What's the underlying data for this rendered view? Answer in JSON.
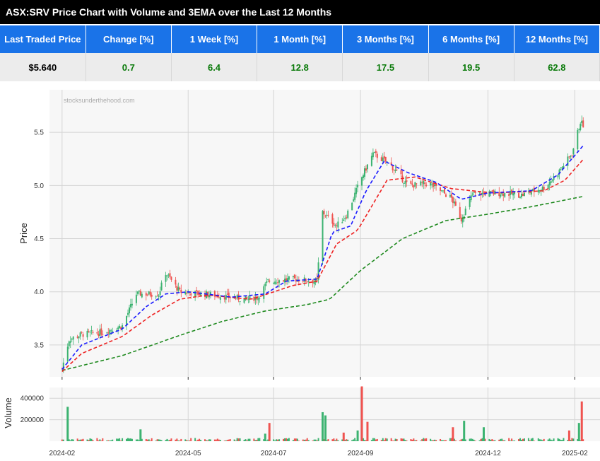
{
  "title": "ASX:SRV Price Chart with Volume and 3EMA over the Last 12 Months",
  "stats": {
    "headers": [
      "Last Traded Price",
      "Change [%]",
      "1 Week [%]",
      "1 Month [%]",
      "3 Months [%]",
      "6 Months [%]",
      "12 Months [%]"
    ],
    "values": [
      "$5.640",
      "0.7",
      "6.4",
      "12.8",
      "17.5",
      "19.5",
      "62.8"
    ]
  },
  "colors": {
    "header_bg": "#1a73e8",
    "positive": "#0a7a0a",
    "up_candle": "#3cb371",
    "down_candle": "#ef5350",
    "ema_fast": "#1a1aff",
    "ema_mid": "#ee2222",
    "ema_slow": "#1f8a1f"
  },
  "chart_data": {
    "type": "candlestick_with_volume",
    "watermark": "stocksunderthehood.com",
    "price_panel": {
      "ylabel": "Price",
      "ylim": [
        3.2,
        5.9
      ],
      "yticks": [
        3.5,
        4.0,
        4.5,
        5.0,
        5.5
      ],
      "ytick_labels": [
        "3.5",
        "4.0",
        "4.5",
        "5.0",
        "5.5"
      ]
    },
    "volume_panel": {
      "ylabel": "Volume",
      "ylim": [
        0,
        500000
      ],
      "yticks": [
        200000,
        400000
      ],
      "ytick_labels": [
        "200000",
        "400000"
      ]
    },
    "x_tick_labels": [
      {
        "date": "2024-02-01",
        "label": "2024-02"
      },
      {
        "date": "2024-05-01",
        "label": "2024-05"
      },
      {
        "date": "2024-07-01",
        "label": "2024-07"
      },
      {
        "date": "2024-09-01",
        "label": "2024-09"
      },
      {
        "date": "2024-12-01",
        "label": "2024-12"
      },
      {
        "date": "2025-02-01",
        "label": "2025-02"
      }
    ],
    "xlim": [
      "2024-01-23",
      "2025-02-19"
    ],
    "price_anchors": [
      [
        "2024-02-01",
        3.28
      ],
      [
        "2024-02-06",
        3.55
      ],
      [
        "2024-02-15",
        3.6
      ],
      [
        "2024-03-01",
        3.62
      ],
      [
        "2024-03-15",
        3.68
      ],
      [
        "2024-03-25",
        3.98
      ],
      [
        "2024-04-10",
        3.98
      ],
      [
        "2024-04-15",
        4.18
      ],
      [
        "2024-04-25",
        4.0
      ],
      [
        "2024-05-20",
        3.97
      ],
      [
        "2024-06-10",
        3.93
      ],
      [
        "2024-06-20",
        3.95
      ],
      [
        "2024-06-27",
        4.1
      ],
      [
        "2024-07-15",
        4.12
      ],
      [
        "2024-08-01",
        4.1
      ],
      [
        "2024-08-05",
        4.75
      ],
      [
        "2024-08-15",
        4.62
      ],
      [
        "2024-08-22",
        4.72
      ],
      [
        "2024-09-01",
        5.05
      ],
      [
        "2024-09-10",
        5.3
      ],
      [
        "2024-09-22",
        5.2
      ],
      [
        "2024-10-05",
        5.0
      ],
      [
        "2024-10-20",
        5.02
      ],
      [
        "2024-11-05",
        4.88
      ],
      [
        "2024-11-12",
        4.68
      ],
      [
        "2024-11-20",
        4.92
      ],
      [
        "2024-12-10",
        4.93
      ],
      [
        "2024-12-25",
        4.91
      ],
      [
        "2025-01-10",
        4.98
      ],
      [
        "2025-01-20",
        5.12
      ],
      [
        "2025-01-30",
        5.3
      ],
      [
        "2025-02-05",
        5.6
      ],
      [
        "2025-02-08",
        5.55
      ]
    ],
    "ema_fast_anchors": [
      [
        "2024-02-01",
        3.27
      ],
      [
        "2024-02-15",
        3.5
      ],
      [
        "2024-03-15",
        3.65
      ],
      [
        "2024-04-01",
        3.86
      ],
      [
        "2024-04-15",
        3.98
      ],
      [
        "2024-05-01",
        4.0
      ],
      [
        "2024-06-01",
        3.95
      ],
      [
        "2024-06-25",
        3.98
      ],
      [
        "2024-07-10",
        4.1
      ],
      [
        "2024-08-01",
        4.12
      ],
      [
        "2024-08-12",
        4.56
      ],
      [
        "2024-08-25",
        4.62
      ],
      [
        "2024-09-05",
        4.95
      ],
      [
        "2024-09-18",
        5.23
      ],
      [
        "2024-10-05",
        5.12
      ],
      [
        "2024-10-25",
        5.03
      ],
      [
        "2024-11-12",
        4.87
      ],
      [
        "2024-12-01",
        4.93
      ],
      [
        "2025-01-01",
        4.95
      ],
      [
        "2025-01-20",
        5.1
      ],
      [
        "2025-02-08",
        5.39
      ]
    ],
    "ema_mid_anchors": [
      [
        "2024-02-01",
        3.25
      ],
      [
        "2024-02-15",
        3.42
      ],
      [
        "2024-03-15",
        3.58
      ],
      [
        "2024-04-05",
        3.78
      ],
      [
        "2024-04-25",
        3.93
      ],
      [
        "2024-05-15",
        3.97
      ],
      [
        "2024-06-15",
        3.93
      ],
      [
        "2024-07-15",
        4.06
      ],
      [
        "2024-08-01",
        4.1
      ],
      [
        "2024-08-15",
        4.45
      ],
      [
        "2024-08-30",
        4.58
      ],
      [
        "2024-09-20",
        5.05
      ],
      [
        "2024-10-10",
        5.08
      ],
      [
        "2024-11-05",
        4.97
      ],
      [
        "2024-12-05",
        4.93
      ],
      [
        "2025-01-10",
        4.95
      ],
      [
        "2025-01-25",
        5.05
      ],
      [
        "2025-02-08",
        5.26
      ]
    ],
    "ema_slow_anchors": [
      [
        "2024-02-01",
        3.26
      ],
      [
        "2024-03-15",
        3.4
      ],
      [
        "2024-04-25",
        3.59
      ],
      [
        "2024-05-25",
        3.72
      ],
      [
        "2024-06-25",
        3.82
      ],
      [
        "2024-07-25",
        3.88
      ],
      [
        "2024-08-10",
        3.93
      ],
      [
        "2024-09-01",
        4.2
      ],
      [
        "2024-10-01",
        4.5
      ],
      [
        "2024-11-01",
        4.67
      ],
      [
        "2024-12-01",
        4.73
      ],
      [
        "2025-01-01",
        4.8
      ],
      [
        "2025-02-08",
        4.9
      ]
    ],
    "volume_spikes": [
      [
        "2024-02-05",
        320000,
        "up"
      ],
      [
        "2024-03-28",
        110000,
        "up"
      ],
      [
        "2024-06-28",
        170000,
        "down"
      ],
      [
        "2024-06-25",
        70000,
        "up"
      ],
      [
        "2024-08-05",
        270000,
        "up"
      ],
      [
        "2024-08-07",
        240000,
        "up"
      ],
      [
        "2024-08-20",
        80000,
        "down"
      ],
      [
        "2024-08-30",
        100000,
        "up"
      ],
      [
        "2024-09-02",
        510000,
        "down"
      ],
      [
        "2024-09-06",
        180000,
        "down"
      ],
      [
        "2024-11-06",
        130000,
        "down"
      ],
      [
        "2024-11-14",
        190000,
        "up"
      ],
      [
        "2024-11-28",
        130000,
        "up"
      ],
      [
        "2025-02-06",
        370000,
        "down"
      ],
      [
        "2025-02-04",
        170000,
        "up"
      ],
      [
        "2025-01-28",
        100000,
        "down"
      ]
    ]
  }
}
